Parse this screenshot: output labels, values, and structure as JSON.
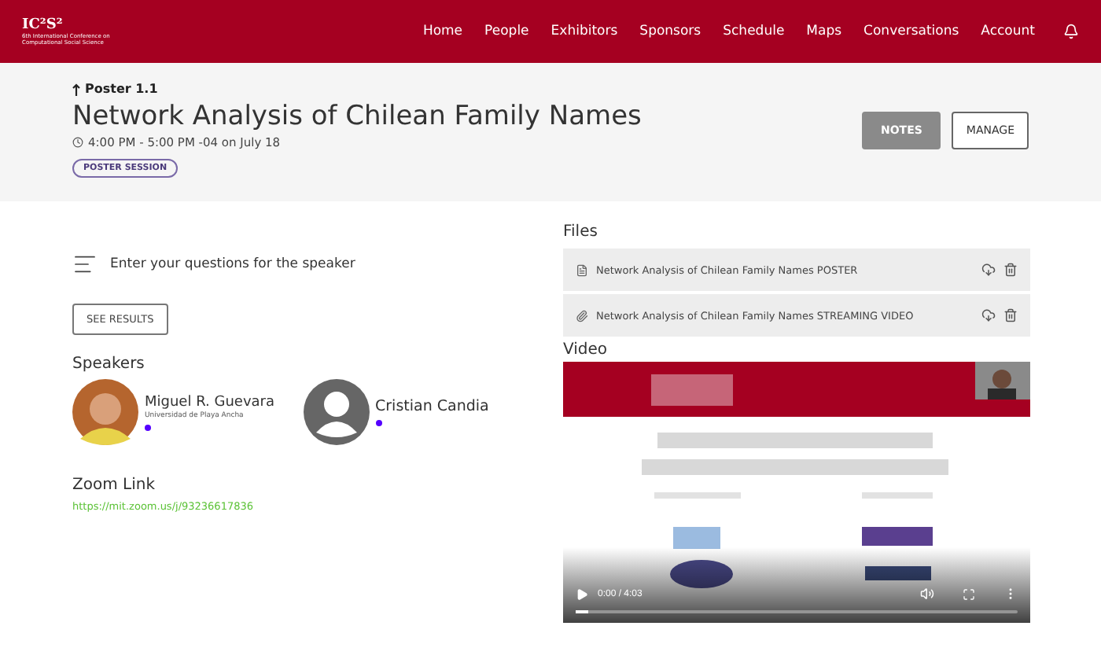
{
  "header": {
    "logo": {
      "mark": "IC²S²",
      "subtitle": "6th International Conference on Computational Social Science"
    },
    "nav": [
      {
        "label": "Home",
        "selected": false
      },
      {
        "label": "People",
        "selected": false
      },
      {
        "label": "Exhibitors",
        "selected": false
      },
      {
        "label": "Sponsors",
        "selected": false
      },
      {
        "label": "Schedule",
        "selected": false
      },
      {
        "label": "Maps",
        "selected": false
      },
      {
        "label": "Conversations",
        "selected": false
      },
      {
        "label": "Account",
        "selected": false
      }
    ]
  },
  "session": {
    "back_label": "Poster 1.1",
    "title": "Network Analysis of Chilean Family Names",
    "time": "4:00 PM - 5:00 PM -04 on July 18",
    "tag": "POSTER SESSION",
    "buttons": [
      {
        "label": "NOTES",
        "kind": "filled"
      },
      {
        "label": "MANAGE",
        "kind": "outline"
      }
    ]
  },
  "questions": {
    "prompt": "Enter your questions for the speaker",
    "button": "SEE RESULTS"
  },
  "speakers": {
    "heading": "Speakers",
    "items": [
      {
        "name": "Miguel R. Guevara",
        "affiliation": "Universidad de Playa Ancha",
        "color": "#5500ff"
      },
      {
        "name": "Cristian Candia",
        "kind": "placeholder",
        "color": "#5500ff"
      }
    ]
  },
  "zoom": {
    "heading": "Zoom Link",
    "url": "https://mit.zoom.us/j/93236617836"
  },
  "files": {
    "heading": "Files",
    "items": [
      {
        "name": "Network Analysis of Chilean Family Names POSTER",
        "kind": "document"
      },
      {
        "name": "Network Analysis of Chilean Family Names STREAMING VIDEO",
        "kind": "link"
      }
    ]
  },
  "video": {
    "heading": "Video",
    "time": "0:00 / 4:03",
    "progress": {
      "level": 0.03
    }
  }
}
